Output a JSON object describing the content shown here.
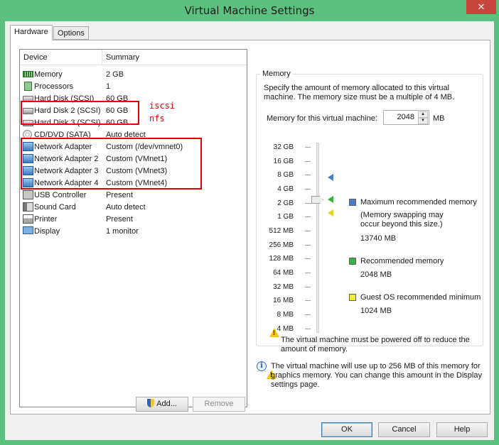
{
  "window": {
    "title": "Virtual Machine Settings",
    "close_glyph": "✕"
  },
  "tabs": [
    {
      "label": "Hardware"
    },
    {
      "label": "Options"
    }
  ],
  "device_list": {
    "columns": {
      "device": "Device",
      "summary": "Summary"
    },
    "rows": [
      {
        "device": "Memory",
        "summary": "2 GB",
        "icon": "memory-icon"
      },
      {
        "device": "Processors",
        "summary": "1",
        "icon": "processor-icon"
      },
      {
        "device": "Hard Disk (SCSI)",
        "summary": "60 GB",
        "icon": "hard-disk-icon"
      },
      {
        "device": "Hard Disk 2 (SCSI)",
        "summary": "60 GB",
        "icon": "hard-disk-icon"
      },
      {
        "device": "Hard Disk 3 (SCSI)",
        "summary": "60 GB",
        "icon": "hard-disk-icon"
      },
      {
        "device": "CD/DVD (SATA)",
        "summary": "Auto detect",
        "icon": "cd-dvd-icon"
      },
      {
        "device": "Network Adapter",
        "summary": "Custom (/dev/vmnet0)",
        "icon": "network-adapter-icon"
      },
      {
        "device": "Network Adapter 2",
        "summary": "Custom (VMnet1)",
        "icon": "network-adapter-icon"
      },
      {
        "device": "Network Adapter 3",
        "summary": "Custom (VMnet3)",
        "icon": "network-adapter-icon"
      },
      {
        "device": "Network Adapter 4",
        "summary": "Custom (VMnet4)",
        "icon": "network-adapter-icon"
      },
      {
        "device": "USB Controller",
        "summary": "Present",
        "icon": "usb-icon"
      },
      {
        "device": "Sound Card",
        "summary": "Auto detect",
        "icon": "sound-card-icon"
      },
      {
        "device": "Printer",
        "summary": "Present",
        "icon": "printer-icon"
      },
      {
        "device": "Display",
        "summary": "1 monitor",
        "icon": "display-icon"
      }
    ]
  },
  "annotations": {
    "iscsi": "iscsi",
    "nfs": "nfs"
  },
  "buttons": {
    "add": "Add...",
    "remove": "Remove",
    "ok": "OK",
    "cancel": "Cancel",
    "help": "Help"
  },
  "memory": {
    "group_title": "Memory",
    "description_line1": "Specify the amount of memory allocated to this virtual",
    "description_line2": "machine. The memory size must be a multiple of 4 MB.",
    "field_label": "Memory for this virtual machine:",
    "value": "2048",
    "unit": "MB",
    "scale": [
      "32 GB",
      "16 GB",
      "8 GB",
      "4 GB",
      "2 GB",
      "1 GB",
      "512 MB",
      "256 MB",
      "128 MB",
      "64 MB",
      "32 MB",
      "16 MB",
      "8 MB",
      "4 MB"
    ],
    "slider_value": "2 GB",
    "legend": {
      "max_label": "Maximum recommended memory",
      "max_note_line1": "(Memory swapping may",
      "max_note_line2": "occur beyond this size.)",
      "max_value": "13740 MB",
      "rec_label": "Recommended memory",
      "rec_value": "2048 MB",
      "guest_label": "Guest OS recommended minimum",
      "guest_value": "1024 MB"
    },
    "colors": {
      "max": "#4a7fc1",
      "recommended": "#3cb043",
      "guest_min": "#e3d81b"
    },
    "warning_line1": "The virtual machine must be powered off to reduce the",
    "warning_line2": "amount of memory.",
    "info_line1": "The virtual machine will use up to 256 MB of this memory for",
    "info_line2": "graphics memory. You can change this amount in the Display",
    "info_line3": "settings page."
  }
}
